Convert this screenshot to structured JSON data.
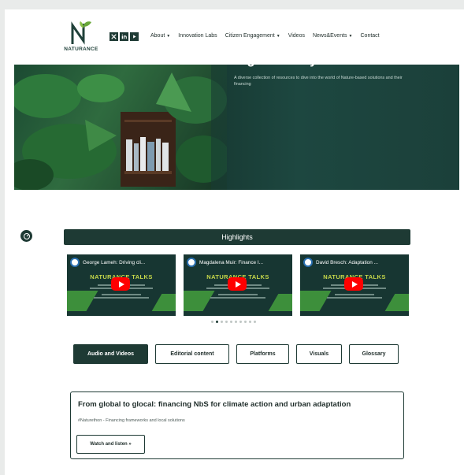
{
  "logo": {
    "text": "NATURANCE"
  },
  "nav": {
    "items": [
      {
        "label": "About",
        "dropdown": true
      },
      {
        "label": "Innovation Labs",
        "dropdown": false
      },
      {
        "label": "Citizen Engagement",
        "dropdown": true
      },
      {
        "label": "Videos",
        "dropdown": false
      },
      {
        "label": "News&Events",
        "dropdown": true
      },
      {
        "label": "Contact",
        "dropdown": false
      }
    ],
    "social_icons": [
      "x-icon",
      "linkedin-icon",
      "youtube-icon"
    ]
  },
  "hero": {
    "title": "Digital library",
    "subtitle": "A diverse collection of resources to dive into the world of Nature-based solutions and their financing"
  },
  "highlights": {
    "title": "Highlights",
    "cards": [
      {
        "title": "George Lameh: Driving cli...",
        "brand": "NATURANCE TALKS"
      },
      {
        "title": "Magdalena Muir: Finance I...",
        "brand": "NATURANCE TALKS"
      },
      {
        "title": "David Bresch: Adaptation ...",
        "brand": "NATURANCE TALKS"
      }
    ],
    "dots": 10,
    "active_dot": 1
  },
  "tabs": [
    {
      "label": "Audio and Videos",
      "active": true
    },
    {
      "label": "Editorial content",
      "active": false
    },
    {
      "label": "Platforms",
      "active": false
    },
    {
      "label": "Visuals",
      "active": false
    },
    {
      "label": "Glossary",
      "active": false
    }
  ],
  "feature": {
    "title": "From global to glocal: financing NbS for climate action and urban adaptation",
    "subtitle": "#Naturethon - Financing frameworks and local solutions",
    "button": "Watch and listen »"
  },
  "colors": {
    "brand_dark": "#1e3a34",
    "accent_green": "#3d8f3b",
    "youtube_red": "#ff0000"
  }
}
